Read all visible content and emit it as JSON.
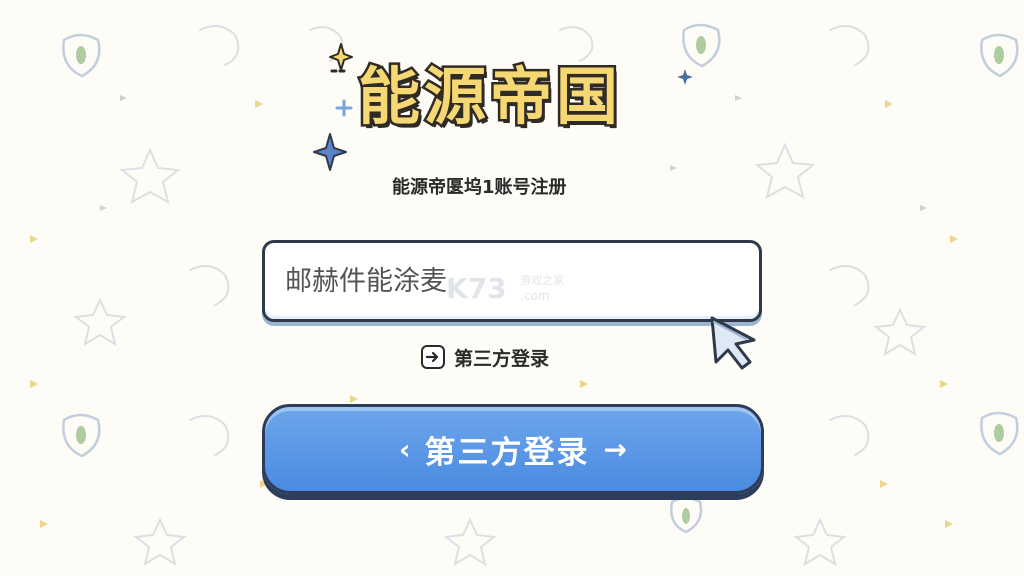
{
  "title": "能源帝国",
  "subtitle": "能源帝匽坞1账号注册",
  "email": {
    "placeholder": "邮赫件能涂麦"
  },
  "third_party_link": {
    "label": "第三方登录",
    "icon": "arrow-box-icon"
  },
  "login_button": {
    "left_glyph": "‹",
    "label": "第三方登录",
    "right_glyph": "→"
  },
  "watermark": {
    "text_main": "K73",
    "text_sub": "游戏之家",
    "text_domain": ".com"
  },
  "colors": {
    "title_fill": "#f5d774",
    "outline": "#2f2a24",
    "button_blue": "#4a8ae0",
    "sparkle_blue": "#5b84c4"
  }
}
